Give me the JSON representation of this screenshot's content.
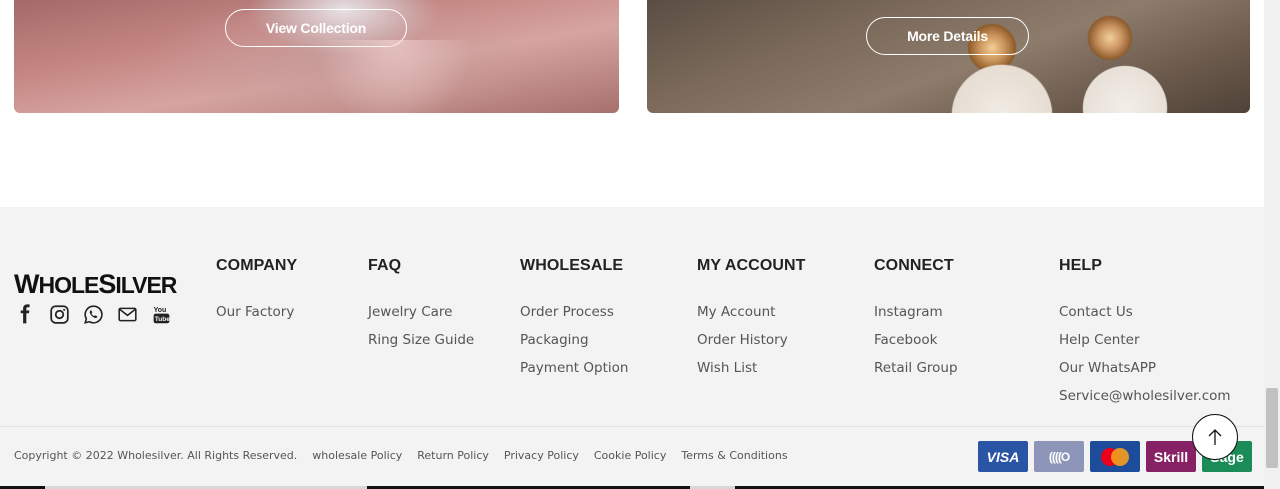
{
  "banners": {
    "left": {
      "button_label": "View Collection"
    },
    "right": {
      "button_label": "More Details"
    }
  },
  "footer": {
    "logo_text_w": "W",
    "logo_text_hole": "HOLE",
    "logo_text_s": "S",
    "logo_text_ilver": "ILVER",
    "socials": [
      "facebook-icon",
      "instagram-icon",
      "whatsapp-icon",
      "email-icon",
      "youtube-icon"
    ],
    "columns": [
      {
        "title": "COMPANY",
        "links": [
          "Our Factory"
        ]
      },
      {
        "title": "FAQ",
        "links": [
          "Jewelry Care",
          "Ring Size Guide"
        ]
      },
      {
        "title": "WHOLESALE",
        "links": [
          "Order Process",
          "Packaging",
          "Payment Option"
        ]
      },
      {
        "title": "MY ACCOUNT",
        "links": [
          "My Account",
          "Order History",
          "Wish List"
        ]
      },
      {
        "title": "CONNECT",
        "links": [
          "Instagram",
          "Facebook",
          "Retail Group"
        ]
      },
      {
        "title": "HELP",
        "links": [
          "Contact Us",
          "Help Center",
          "Our WhatsAPP",
          "Service@wholesilver.com"
        ]
      }
    ],
    "copyright": "Copyright © 2022 Wholesilver. All Rights Reserved.",
    "policies": [
      "wholesale Policy",
      "Return Policy",
      "Privacy Policy",
      "Cookie Policy",
      "Terms & Conditions"
    ],
    "payments": {
      "visa": "VISA",
      "maestro": "((((O",
      "mastercard": "mastercard",
      "skrill": "Skrill",
      "sage": "Sage"
    }
  },
  "colors": {
    "footer_bg": "#f3f3f3",
    "text": "#555555",
    "heading": "#222222"
  }
}
